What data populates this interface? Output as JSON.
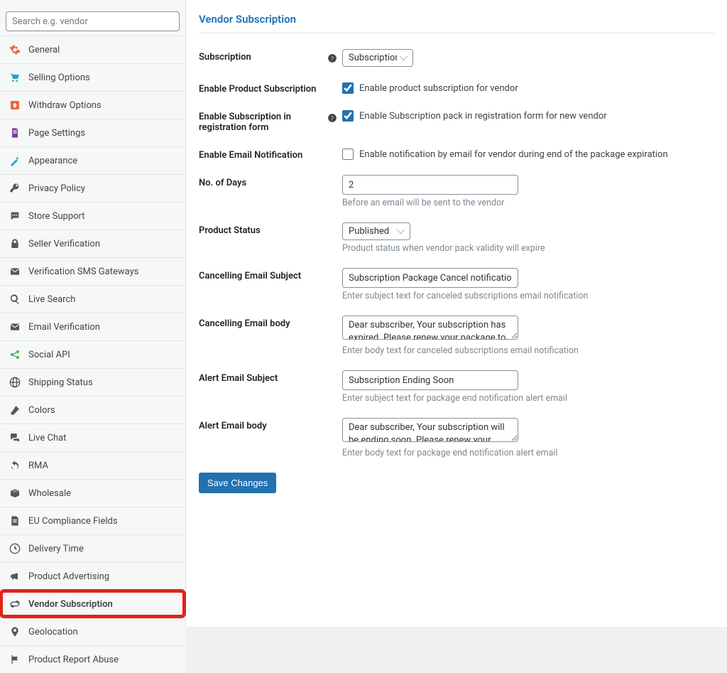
{
  "sidebar": {
    "search_placeholder": "Search e.g. vendor",
    "items": [
      {
        "label": "General",
        "icon": "gear",
        "color": "#f0643b"
      },
      {
        "label": "Selling Options",
        "icon": "cart",
        "color": "#1aa7d0"
      },
      {
        "label": "Withdraw Options",
        "icon": "up",
        "color": "#f0643b"
      },
      {
        "label": "Page Settings",
        "icon": "page",
        "color": "#7b3fa0"
      },
      {
        "label": "Appearance",
        "icon": "magic",
        "color": "#1aa7d0"
      },
      {
        "label": "Privacy Policy",
        "icon": "key",
        "color": "#50575e"
      },
      {
        "label": "Store Support",
        "icon": "chat",
        "color": "#50575e"
      },
      {
        "label": "Seller Verification",
        "icon": "lock",
        "color": "#50575e"
      },
      {
        "label": "Verification SMS Gateways",
        "icon": "mail",
        "color": "#50575e"
      },
      {
        "label": "Live Search",
        "icon": "search",
        "color": "#50575e"
      },
      {
        "label": "Email Verification",
        "icon": "mail",
        "color": "#50575e"
      },
      {
        "label": "Social API",
        "icon": "share",
        "color": "#4caf50"
      },
      {
        "label": "Shipping Status",
        "icon": "globe",
        "color": "#50575e"
      },
      {
        "label": "Colors",
        "icon": "brush",
        "color": "#50575e"
      },
      {
        "label": "Live Chat",
        "icon": "chats",
        "color": "#50575e"
      },
      {
        "label": "RMA",
        "icon": "undo",
        "color": "#50575e"
      },
      {
        "label": "Wholesale",
        "icon": "box",
        "color": "#50575e"
      },
      {
        "label": "EU Compliance Fields",
        "icon": "doc",
        "color": "#50575e"
      },
      {
        "label": "Delivery Time",
        "icon": "clock",
        "color": "#50575e"
      },
      {
        "label": "Product Advertising",
        "icon": "megaphone",
        "color": "#50575e"
      },
      {
        "label": "Vendor Subscription",
        "icon": "loop",
        "color": "#50575e",
        "active": true
      },
      {
        "label": "Geolocation",
        "icon": "pin",
        "color": "#50575e"
      },
      {
        "label": "Product Report Abuse",
        "icon": "flag",
        "color": "#50575e"
      }
    ]
  },
  "page": {
    "title": "Vendor Subscription",
    "save_button": "Save Changes"
  },
  "form": {
    "subscription": {
      "label": "Subscription",
      "value": "Subscriptions",
      "help": true
    },
    "enable_product_sub": {
      "label": "Enable Product Subscription",
      "checkbox_label": "Enable product subscription for vendor",
      "checked": true
    },
    "enable_reg": {
      "label": "Enable Subscription in registration form",
      "checkbox_label": "Enable Subscription pack in registration form for new vendor",
      "checked": true,
      "help": true
    },
    "enable_email_notif": {
      "label": "Enable Email Notification",
      "checkbox_label": "Enable notification by email for vendor during end of the package expiration",
      "checked": false
    },
    "no_of_days": {
      "label": "No. of Days",
      "value": "2",
      "hint": "Before an email will be sent to the vendor"
    },
    "product_status": {
      "label": "Product Status",
      "value": "Published",
      "hint": "Product status when vendor pack validity will expire"
    },
    "cancel_subject": {
      "label": "Cancelling Email Subject",
      "value": "Subscription Package Cancel notification",
      "hint": "Enter subject text for canceled subscriptions email notification"
    },
    "cancel_body": {
      "label": "Cancelling Email body",
      "value": "Dear subscriber, Your subscription has expired. Please renew your package to continue using it.",
      "hint": "Enter body text for canceled subscriptions email notification"
    },
    "alert_subject": {
      "label": "Alert Email Subject",
      "value": "Subscription Ending Soon",
      "hint": "Enter subject text for package end notification alert email"
    },
    "alert_body": {
      "label": "Alert Email body",
      "value": "Dear subscriber, Your subscription will be ending soon. Please renew your package in a timely",
      "hint": "Enter body text for package end notification alert email"
    }
  }
}
